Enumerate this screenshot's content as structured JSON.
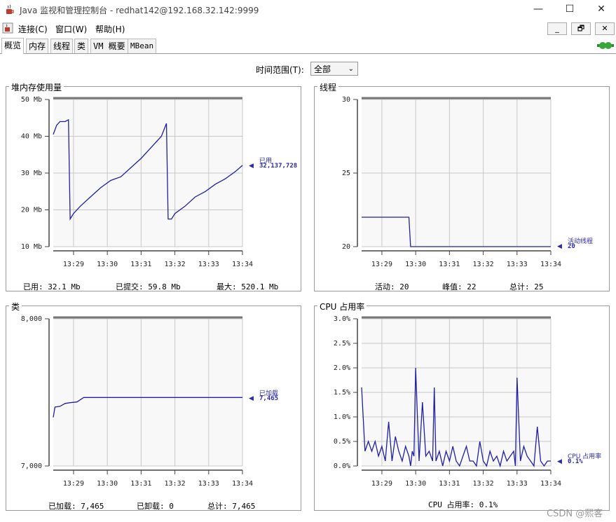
{
  "window": {
    "title": "Java 监视和管理控制台 - redhat142@192.168.32.142:9999",
    "minimize": "—",
    "maximize": "☐",
    "close": "✕"
  },
  "menu": [
    "连接(C)",
    "窗口(W)",
    "帮助(H)"
  ],
  "inner_buttons": [
    "_",
    "🗗",
    "✕"
  ],
  "tabs": [
    "概览",
    "内存",
    "线程",
    "类",
    "VM 概要",
    "MBean"
  ],
  "time_range": {
    "label": "时间范围(T):",
    "value": "全部"
  },
  "watermark": "CSDN @熙客",
  "panels": {
    "heap": {
      "title": "堆内存使用量",
      "legend_name": "已用",
      "legend_value": "32,137,728",
      "stats": [
        "已用:  32.1  Mb",
        "已提交:  59.8  Mb",
        "最大:  520.1  Mb"
      ]
    },
    "threads": {
      "title": "线程",
      "legend_name": "活动线程",
      "legend_value": "20",
      "stats": [
        "活动:  20",
        "峰值:  22",
        "总计:  25"
      ]
    },
    "classes": {
      "title": "类",
      "legend_name": "已加载",
      "legend_value": "7,465",
      "stats": [
        "已加载:  7,465",
        "已卸载:  0",
        "总计:  7,465"
      ]
    },
    "cpu": {
      "title": "CPU 占用率",
      "legend_name": "CPU 占用率",
      "legend_value": "0.1%",
      "stats": [
        "CPU 占用率:  0.1%"
      ]
    }
  },
  "chart_data": [
    {
      "type": "line",
      "title": "堆内存使用量",
      "y_tick_labels": [
        "50 Mb",
        "40 Mb",
        "30 Mb",
        "20 Mb",
        "10 Mb"
      ],
      "ylim": [
        10,
        50
      ],
      "x_tick_labels": [
        "13:29",
        "13:30",
        "13:31",
        "13:32",
        "13:33",
        "13:34"
      ],
      "xlim": [
        "13:28.4",
        "13:34"
      ],
      "grid": true,
      "series": [
        {
          "name": "已用",
          "x": [
            28.4,
            28.5,
            28.6,
            28.75,
            28.85,
            28.9,
            29.0,
            29.2,
            29.5,
            29.8,
            30.1,
            30.4,
            30.7,
            31.0,
            31.3,
            31.6,
            31.75,
            31.8,
            31.9,
            32.0,
            32.3,
            32.6,
            32.9,
            33.2,
            33.5,
            33.8,
            34.0
          ],
          "y": [
            40.5,
            43,
            44,
            44,
            44.5,
            17.5,
            19,
            21,
            23.5,
            26,
            28,
            29,
            31.5,
            34,
            37,
            40,
            43.5,
            17.5,
            17.5,
            19,
            21,
            23.5,
            25,
            27,
            28.5,
            30.5,
            32.1
          ]
        }
      ]
    },
    {
      "type": "line",
      "title": "线程",
      "y_tick_labels": [
        "30",
        "25",
        "20"
      ],
      "ylim": [
        20,
        30
      ],
      "x_tick_labels": [
        "13:29",
        "13:30",
        "13:31",
        "13:32",
        "13:33",
        "13:34"
      ],
      "xlim": [
        "13:28.4",
        "13:34"
      ],
      "grid": true,
      "series": [
        {
          "name": "活动线程",
          "x": [
            28.4,
            29.8,
            29.85,
            34.0
          ],
          "y": [
            22,
            22,
            20,
            20
          ]
        }
      ]
    },
    {
      "type": "line",
      "title": "类",
      "y_tick_labels": [
        "8,000",
        "7,000"
      ],
      "ylim": [
        7000,
        8000
      ],
      "x_tick_labels": [
        "13:29",
        "13:30",
        "13:31",
        "13:32",
        "13:33",
        "13:34"
      ],
      "xlim": [
        "13:28.4",
        "13:34"
      ],
      "grid": true,
      "series": [
        {
          "name": "已加载",
          "x": [
            28.4,
            28.45,
            28.6,
            28.75,
            28.9,
            29.1,
            29.3,
            34.0
          ],
          "y": [
            7330,
            7400,
            7405,
            7425,
            7430,
            7435,
            7465,
            7465
          ]
        }
      ]
    },
    {
      "type": "line",
      "title": "CPU 占用率",
      "y_tick_labels": [
        "3.0%",
        "2.5%",
        "2.0%",
        "1.5%",
        "1.0%",
        "0.5%",
        "0.0%"
      ],
      "ylim": [
        0,
        3
      ],
      "x_tick_labels": [
        "13:29",
        "13:30",
        "13:31",
        "13:32",
        "13:33",
        "13:34"
      ],
      "xlim": [
        "13:28.4",
        "13:34"
      ],
      "grid": true,
      "series": [
        {
          "name": "CPU 占用率",
          "x": [
            28.4,
            28.5,
            28.6,
            28.7,
            28.8,
            28.9,
            29.0,
            29.1,
            29.2,
            29.3,
            29.4,
            29.5,
            29.6,
            29.7,
            29.8,
            29.85,
            29.9,
            29.95,
            30.0,
            30.1,
            30.2,
            30.3,
            30.4,
            30.5,
            30.55,
            30.6,
            30.7,
            30.8,
            30.9,
            31.0,
            31.1,
            31.2,
            31.3,
            31.4,
            31.5,
            31.6,
            31.7,
            31.8,
            31.9,
            32.0,
            32.1,
            32.2,
            32.3,
            32.4,
            32.5,
            32.6,
            32.7,
            32.8,
            32.9,
            32.95,
            33.0,
            33.1,
            33.2,
            33.3,
            33.4,
            33.5,
            33.6,
            33.7,
            33.8,
            33.9,
            34.0
          ],
          "y": [
            1.6,
            0.3,
            0.5,
            0.3,
            0.5,
            0.2,
            0.4,
            0.1,
            0.9,
            0.1,
            0.6,
            0.3,
            0.1,
            0.4,
            0.2,
            0.0,
            0.3,
            0.2,
            2.0,
            0.1,
            1.3,
            0.2,
            0.3,
            0.1,
            1.6,
            0.1,
            0.3,
            0.0,
            0.3,
            0.1,
            0.4,
            0.1,
            0.0,
            0.2,
            0.4,
            0.1,
            0.1,
            0.0,
            0.5,
            0.1,
            0.0,
            0.3,
            0.1,
            0.2,
            0.0,
            0.3,
            0.1,
            0.2,
            0.3,
            0.0,
            1.8,
            0.1,
            0.4,
            0.2,
            0.1,
            0.0,
            0.8,
            0.1,
            0.0,
            0.1,
            0.1
          ]
        }
      ]
    }
  ]
}
